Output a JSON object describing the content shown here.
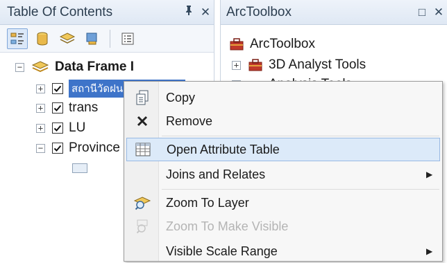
{
  "toc": {
    "title": "Table Of Contents",
    "pin_glyph": "ᵖ",
    "close_glyph": "✕",
    "tree": {
      "data_frame": "Data Frame I",
      "layers": [
        {
          "name": "สถานีวัดฝน",
          "checked": true,
          "selected": true
        },
        {
          "name": "trans",
          "checked": true
        },
        {
          "name": "LU",
          "checked": true
        },
        {
          "name": "Province",
          "checked": true
        }
      ]
    }
  },
  "arctoolbox": {
    "title": "ArcToolbox",
    "restore_glyph": "□",
    "close_glyph": "✕",
    "root": "ArcToolbox",
    "items": [
      "3D Analyst Tools",
      "Analysis Tools"
    ]
  },
  "context_menu": {
    "items": [
      {
        "label": "Copy",
        "icon": "copy-icon"
      },
      {
        "label": "Remove",
        "icon": "remove-icon"
      },
      {
        "label": "Open Attribute Table",
        "icon": "table-icon",
        "highlighted": true
      },
      {
        "label": "Joins and Relates",
        "submenu": true
      },
      {
        "label": "Zoom To Layer",
        "icon": "zoom-to-layer-icon"
      },
      {
        "label": "Zoom To Make Visible",
        "icon": "zoom-visible-icon",
        "disabled": true
      },
      {
        "label": "Visible Scale Range",
        "submenu": true
      }
    ]
  },
  "colors": {
    "selection": "#3e74c9",
    "menu_highlight": "#dceaf9"
  }
}
